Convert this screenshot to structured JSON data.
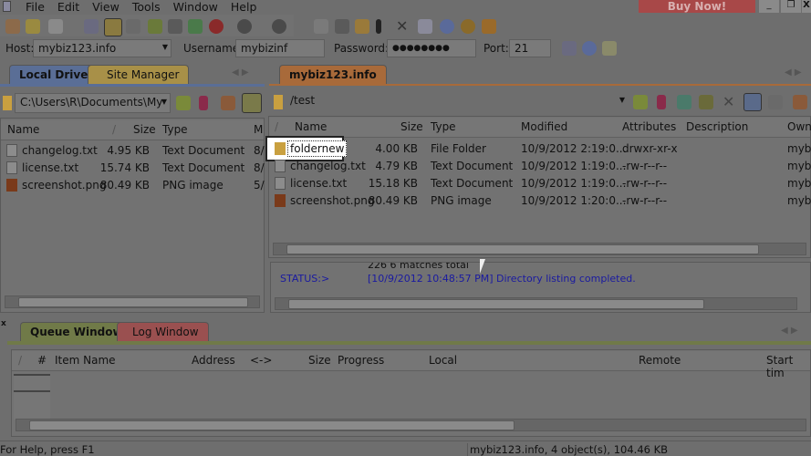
{
  "menu": [
    "File",
    "Edit",
    "View",
    "Tools",
    "Window",
    "Help"
  ],
  "buy_now": "Buy Now!",
  "window_controls": [
    "_",
    "❐",
    "X"
  ],
  "connect": {
    "host_label": "Host:",
    "host": "mybiz123.info",
    "user_label": "Username:",
    "user": "mybizinf",
    "pass_label": "Password:",
    "pass": "●●●●●●●●",
    "port_label": "Port:",
    "port": "21"
  },
  "left": {
    "tabs": [
      "Local Drives",
      "Site Manager"
    ],
    "path": "C:\\Users\\R\\Documents\\My",
    "columns": [
      "Name",
      "/",
      "Size",
      "Type",
      "M"
    ],
    "rows": [
      {
        "name": "changelog.txt",
        "size": "4.95 KB",
        "type": "Text Document",
        "m": "8/",
        "icon": "text-file"
      },
      {
        "name": "license.txt",
        "size": "15.74 KB",
        "type": "Text Document",
        "m": "8/",
        "icon": "text-file"
      },
      {
        "name": "screenshot.png",
        "size": "80.49 KB",
        "type": "PNG image",
        "m": "5/",
        "icon": "image-file"
      }
    ]
  },
  "right": {
    "tab": "mybiz123.info",
    "path": "/test",
    "columns": [
      "/",
      "Name",
      "Size",
      "Type",
      "Modified",
      "Attributes",
      "Description",
      "Owner"
    ],
    "rows": [
      {
        "name": "foldernew",
        "size": "4.00 KB",
        "type": "File Folder",
        "modified": "10/9/2012 2:19:0...",
        "attr": "drwxr-xr-x",
        "owner": "mybi",
        "icon": "folder"
      },
      {
        "name": "changelog.txt",
        "size": "4.79 KB",
        "type": "Text Document",
        "modified": "10/9/2012 1:19:0...",
        "attr": "-rw-r--r--",
        "owner": "mybi",
        "icon": "text-file"
      },
      {
        "name": "license.txt",
        "size": "15.18 KB",
        "type": "Text Document",
        "modified": "10/9/2012 1:19:0...",
        "attr": "-rw-r--r--",
        "owner": "mybi",
        "icon": "text-file"
      },
      {
        "name": "screenshot.png",
        "size": "80.49 KB",
        "type": "PNG image",
        "modified": "10/9/2012 1:20:0...",
        "attr": "-rw-r--r--",
        "owner": "mybi",
        "icon": "image-file"
      }
    ]
  },
  "log": {
    "prev": "226 6 matches total",
    "label": "STATUS:>",
    "message": "[10/9/2012 10:48:57 PM] Directory listing completed."
  },
  "queue": {
    "tabs": [
      "Queue Window",
      "Log Window"
    ],
    "columns": [
      "/",
      "#",
      "Item Name",
      "Address",
      "<->",
      "Size",
      "Progress",
      "Local",
      "Remote",
      "Start tim"
    ]
  },
  "status": {
    "help": "For Help, press F1",
    "info": "mybiz123.info, 4 object(s), 104.46 KB"
  },
  "colors": {
    "log_text": "#1a1aa0",
    "buy_now": "#a84848",
    "local_tab": "#5a6e96",
    "site_tab": "#a89048",
    "remote_tab": "#a86a3a",
    "queue_tab": "#707a48",
    "log_tab": "#9a5050"
  }
}
